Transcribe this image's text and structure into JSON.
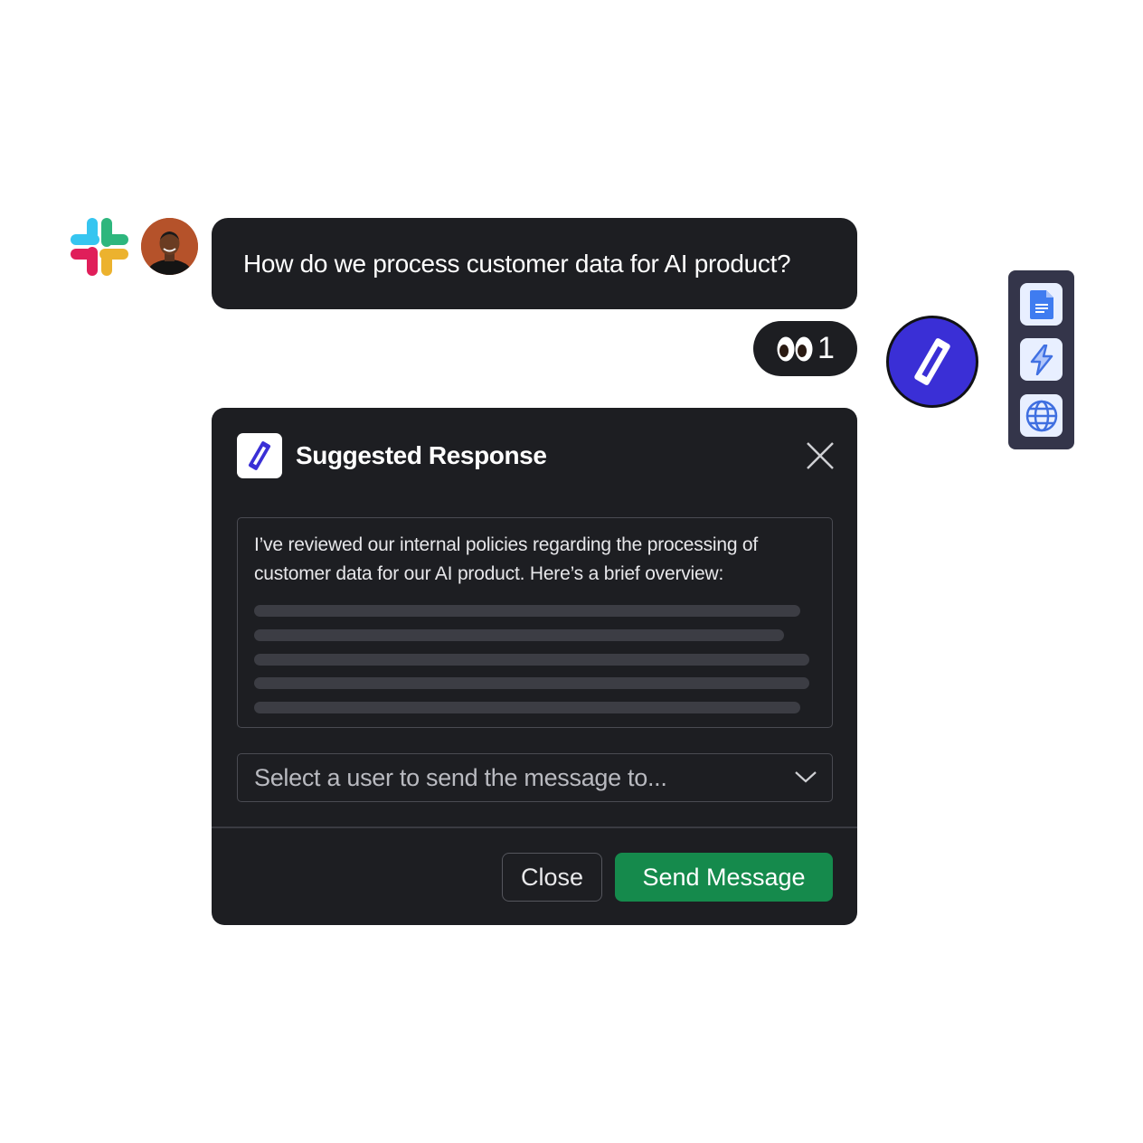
{
  "chat": {
    "question": "How do we process customer data for AI product?",
    "reaction": {
      "emoji": "👀",
      "count": "1"
    }
  },
  "sources": [
    {
      "icon": "google-docs-icon"
    },
    {
      "icon": "lightning-icon"
    },
    {
      "icon": "globe-icon"
    }
  ],
  "card": {
    "title": "Suggested Response",
    "response_text": "I’ve reviewed our internal policies regarding the processing of customer data for our AI product. Here’s a brief overview:",
    "select_placeholder": "Select a user to send the message to...",
    "close_label": "Close",
    "send_label": "Send Message"
  },
  "colors": {
    "card_bg": "#1d1e22",
    "send_button": "#158a4c",
    "brand_purple": "#3a2fd6",
    "sources_panel": "#34354a"
  }
}
